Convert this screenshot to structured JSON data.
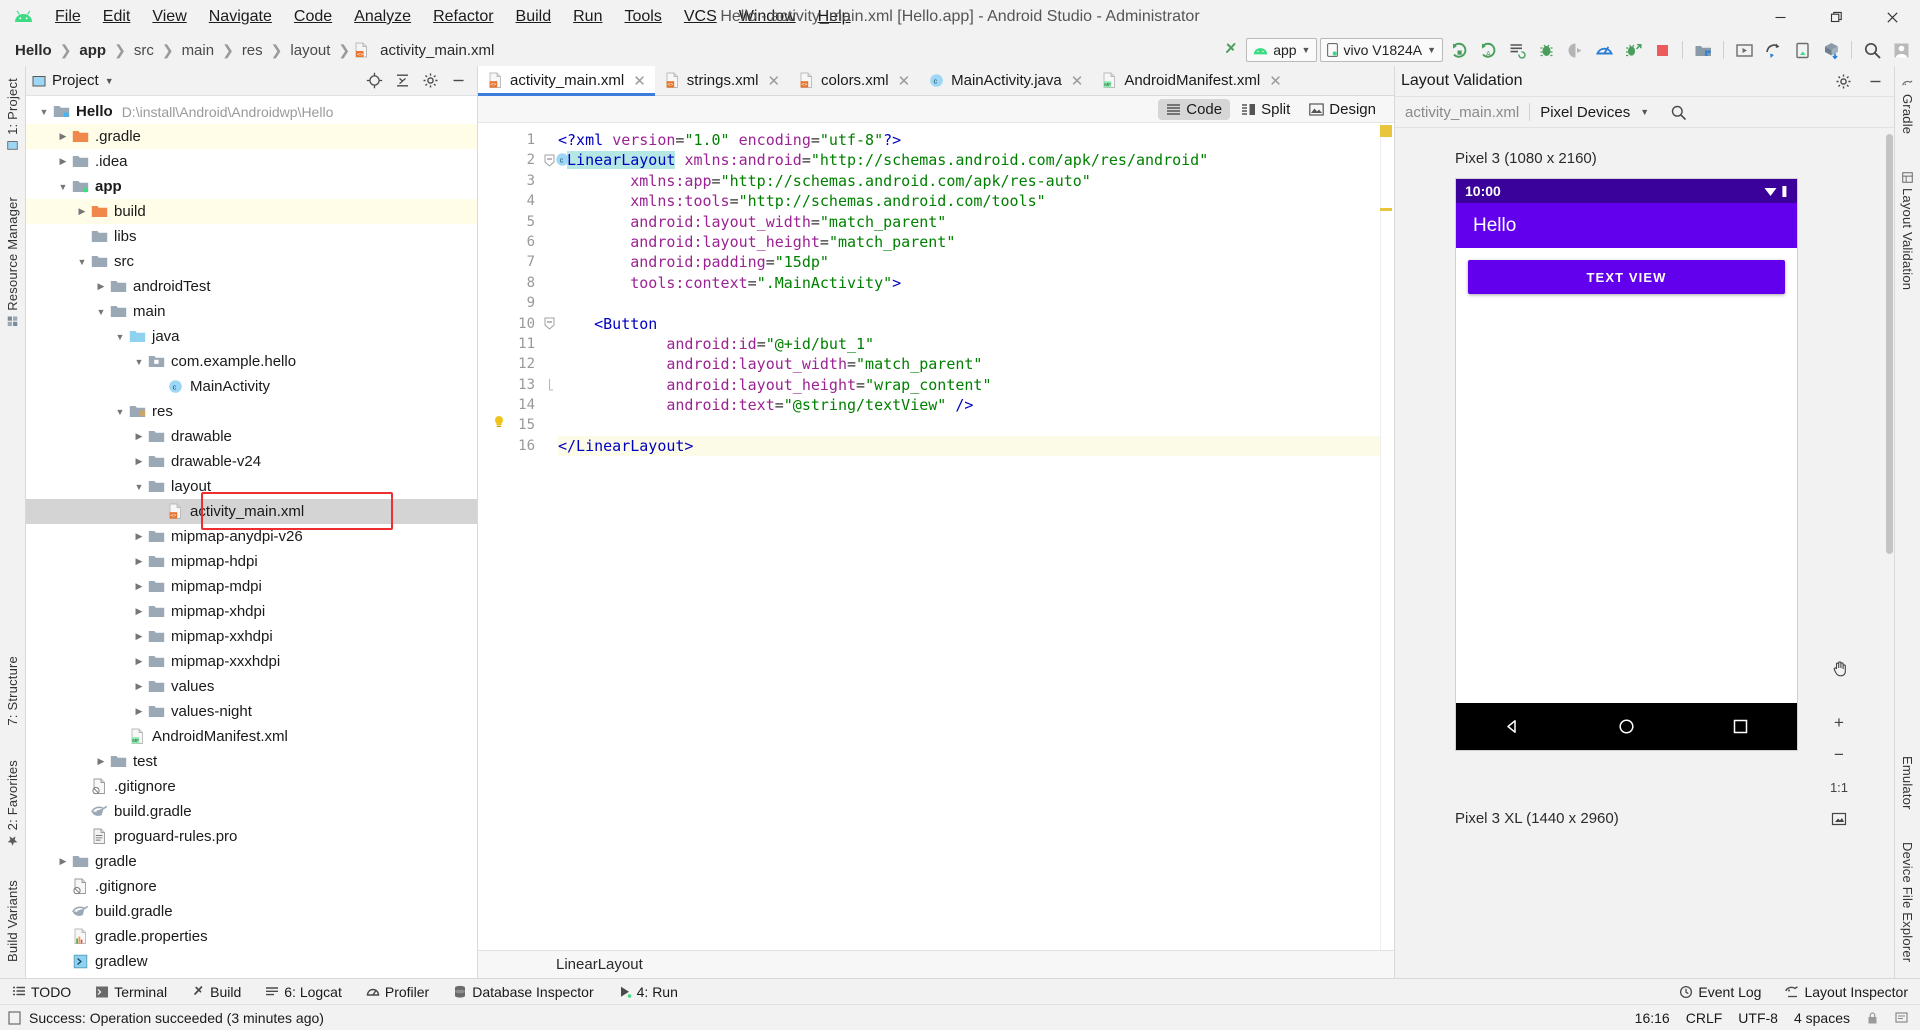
{
  "window": {
    "title": "Hello - activity_main.xml [Hello.app] - Android Studio - Administrator",
    "minimize": "—",
    "maximize": "❐",
    "close": "✕"
  },
  "menu": [
    {
      "label": "File"
    },
    {
      "label": "Edit"
    },
    {
      "label": "View"
    },
    {
      "label": "Navigate"
    },
    {
      "label": "Code"
    },
    {
      "label": "Analyze"
    },
    {
      "label": "Refactor"
    },
    {
      "label": "Build"
    },
    {
      "label": "Run"
    },
    {
      "label": "Tools"
    },
    {
      "label": "VCS"
    },
    {
      "label": "Window"
    },
    {
      "label": "Help"
    }
  ],
  "breadcrumbs": [
    {
      "label": "Hello",
      "style": "bold"
    },
    {
      "label": "app",
      "style": "bold"
    },
    {
      "label": "src",
      "style": "dim"
    },
    {
      "label": "main",
      "style": "dim"
    },
    {
      "label": "res",
      "style": "dim"
    },
    {
      "label": "layout",
      "style": "dim"
    },
    {
      "label": "activity_main.xml",
      "style": "file"
    }
  ],
  "toolbar": {
    "run_config": "app",
    "device": "vivo V1824A",
    "icons": [
      "run-icon",
      "debug-run-icon",
      "apply-changes-icon",
      "debug-icon",
      "attach-debugger-icon",
      "profiler-icon",
      "run-with-coverage-icon",
      "stop-icon",
      "sdk-manager-icon",
      "avd-manager-icon",
      "sync-project-icon",
      "device-manager-icon",
      "gradle-sync-icon",
      "search-icon",
      "user-icon"
    ]
  },
  "left_strips": [
    {
      "label": "1: Project",
      "name": "project"
    },
    {
      "label": "Resource Manager",
      "name": "resource-manager"
    },
    {
      "label": "7: Structure",
      "name": "structure"
    },
    {
      "label": "2: Favorites",
      "name": "favorites"
    },
    {
      "label": "Build Variants",
      "name": "build-variants"
    }
  ],
  "right_strips": [
    {
      "label": "Gradle",
      "name": "gradle"
    },
    {
      "label": "Layout Validation",
      "name": "layout-validation"
    },
    {
      "label": "Emulator",
      "name": "emulator"
    },
    {
      "label": "Device File Explorer",
      "name": "device-file-explorer"
    }
  ],
  "project_panel": {
    "title": "Project",
    "tree": [
      {
        "depth": 0,
        "arrow": "down",
        "icon": "module-root",
        "label": "Hello",
        "bold": true,
        "path": "D:\\install\\Android\\Androidwp\\Hello"
      },
      {
        "depth": 1,
        "arrow": "right",
        "icon": "folder-orange",
        "label": ".gradle",
        "highlight": "yellow"
      },
      {
        "depth": 1,
        "arrow": "right",
        "icon": "folder-gray",
        "label": ".idea"
      },
      {
        "depth": 1,
        "arrow": "down",
        "icon": "module",
        "label": "app",
        "bold": true
      },
      {
        "depth": 2,
        "arrow": "right",
        "icon": "folder-orange",
        "label": "build",
        "highlight": "yellow"
      },
      {
        "depth": 2,
        "arrow": "none",
        "icon": "folder-gray",
        "label": "libs"
      },
      {
        "depth": 2,
        "arrow": "down",
        "icon": "folder-gray",
        "label": "src"
      },
      {
        "depth": 3,
        "arrow": "right",
        "icon": "folder-gray",
        "label": "androidTest"
      },
      {
        "depth": 3,
        "arrow": "down",
        "icon": "folder-gray",
        "label": "main"
      },
      {
        "depth": 4,
        "arrow": "down",
        "icon": "folder-blue",
        "label": "java"
      },
      {
        "depth": 5,
        "arrow": "down",
        "icon": "package",
        "label": "com.example.hello"
      },
      {
        "depth": 6,
        "arrow": "none",
        "icon": "class",
        "label": "MainActivity"
      },
      {
        "depth": 4,
        "arrow": "down",
        "icon": "res-folder",
        "label": "res"
      },
      {
        "depth": 5,
        "arrow": "right",
        "icon": "folder-gray",
        "label": "drawable"
      },
      {
        "depth": 5,
        "arrow": "right",
        "icon": "folder-gray",
        "label": "drawable-v24"
      },
      {
        "depth": 5,
        "arrow": "down",
        "icon": "folder-gray",
        "label": "layout"
      },
      {
        "depth": 6,
        "arrow": "none",
        "icon": "xml-file",
        "label": "activity_main.xml",
        "selected": true,
        "boxed": true
      },
      {
        "depth": 5,
        "arrow": "right",
        "icon": "folder-gray",
        "label": "mipmap-anydpi-v26"
      },
      {
        "depth": 5,
        "arrow": "right",
        "icon": "folder-gray",
        "label": "mipmap-hdpi"
      },
      {
        "depth": 5,
        "arrow": "right",
        "icon": "folder-gray",
        "label": "mipmap-mdpi"
      },
      {
        "depth": 5,
        "arrow": "right",
        "icon": "folder-gray",
        "label": "mipmap-xhdpi"
      },
      {
        "depth": 5,
        "arrow": "right",
        "icon": "folder-gray",
        "label": "mipmap-xxhdpi"
      },
      {
        "depth": 5,
        "arrow": "right",
        "icon": "folder-gray",
        "label": "mipmap-xxxhdpi"
      },
      {
        "depth": 5,
        "arrow": "right",
        "icon": "folder-gray",
        "label": "values"
      },
      {
        "depth": 5,
        "arrow": "right",
        "icon": "folder-gray",
        "label": "values-night"
      },
      {
        "depth": 4,
        "arrow": "none",
        "icon": "manifest-file",
        "label": "AndroidManifest.xml"
      },
      {
        "depth": 3,
        "arrow": "right",
        "icon": "folder-gray",
        "label": "test"
      },
      {
        "depth": 2,
        "arrow": "none",
        "icon": "gitignore-file",
        "label": ".gitignore"
      },
      {
        "depth": 2,
        "arrow": "none",
        "icon": "gradle-file",
        "label": "build.gradle"
      },
      {
        "depth": 2,
        "arrow": "none",
        "icon": "text-file",
        "label": "proguard-rules.pro"
      },
      {
        "depth": 1,
        "arrow": "right",
        "icon": "folder-gray",
        "label": "gradle"
      },
      {
        "depth": 1,
        "arrow": "none",
        "icon": "gitignore-file",
        "label": ".gitignore"
      },
      {
        "depth": 1,
        "arrow": "none",
        "icon": "gradle-file",
        "label": "build.gradle"
      },
      {
        "depth": 1,
        "arrow": "none",
        "icon": "properties-file",
        "label": "gradle.properties"
      },
      {
        "depth": 1,
        "arrow": "none",
        "icon": "script-file",
        "label": "gradlew"
      }
    ]
  },
  "editor": {
    "tabs": [
      {
        "label": "activity_main.xml",
        "icon": "xml-file",
        "active": true
      },
      {
        "label": "strings.xml",
        "icon": "xml-file",
        "active": false
      },
      {
        "label": "colors.xml",
        "icon": "xml-file",
        "active": false
      },
      {
        "label": "MainActivity.java",
        "icon": "class",
        "active": false
      },
      {
        "label": "AndroidManifest.xml",
        "icon": "manifest-file",
        "active": false
      }
    ],
    "modes": [
      {
        "label": "Code",
        "selected": true,
        "icon": "code-view-icon"
      },
      {
        "label": "Split",
        "selected": false,
        "icon": "split-view-icon"
      },
      {
        "label": "Design",
        "selected": false,
        "icon": "design-view-icon"
      }
    ],
    "breadcrumb": "LinearLayout",
    "lines": [
      {
        "n": 1,
        "indent": 0,
        "tokens": [
          {
            "t": "decl",
            "v": "<?xml "
          },
          {
            "t": "attr",
            "v": "version"
          },
          {
            "t": "punc",
            "v": "="
          },
          {
            "t": "val",
            "v": "\"1.0\""
          },
          {
            "t": "punc",
            "v": " "
          },
          {
            "t": "attr",
            "v": "encoding"
          },
          {
            "t": "punc",
            "v": "="
          },
          {
            "t": "val",
            "v": "\"utf-8\""
          },
          {
            "t": "decl",
            "v": "?>"
          }
        ]
      },
      {
        "n": 2,
        "indent": 0,
        "gmark": "class-marker",
        "fold": "open",
        "tokens": [
          {
            "t": "tag",
            "v": "<"
          },
          {
            "t": "tagsel",
            "v": "LinearLayout"
          },
          {
            "t": "punc",
            "v": " "
          },
          {
            "t": "attr",
            "v": "xmlns:android"
          },
          {
            "t": "punc",
            "v": "="
          },
          {
            "t": "val",
            "v": "\"http://schemas.android.com/apk/res/android\""
          }
        ]
      },
      {
        "n": 3,
        "indent": 4,
        "tokens": [
          {
            "t": "attr",
            "v": "xmlns:app"
          },
          {
            "t": "punc",
            "v": "="
          },
          {
            "t": "val",
            "v": "\"http://schemas.android.com/apk/res-auto\""
          }
        ]
      },
      {
        "n": 4,
        "indent": 4,
        "tokens": [
          {
            "t": "attr",
            "v": "xmlns:tools"
          },
          {
            "t": "punc",
            "v": "="
          },
          {
            "t": "val",
            "v": "\"http://schemas.android.com/tools\""
          }
        ]
      },
      {
        "n": 5,
        "indent": 4,
        "tokens": [
          {
            "t": "attr",
            "v": "android:layout_width"
          },
          {
            "t": "punc",
            "v": "="
          },
          {
            "t": "val",
            "v": "\"match_parent\""
          }
        ]
      },
      {
        "n": 6,
        "indent": 4,
        "tokens": [
          {
            "t": "attr",
            "v": "android:layout_height"
          },
          {
            "t": "punc",
            "v": "="
          },
          {
            "t": "val",
            "v": "\"match_parent\""
          }
        ]
      },
      {
        "n": 7,
        "indent": 4,
        "tokens": [
          {
            "t": "attr",
            "v": "android:padding"
          },
          {
            "t": "punc",
            "v": "="
          },
          {
            "t": "val",
            "v": "\"15dp\""
          }
        ]
      },
      {
        "n": 8,
        "indent": 4,
        "tokens": [
          {
            "t": "attr",
            "v": "tools:context"
          },
          {
            "t": "punc",
            "v": "="
          },
          {
            "t": "val",
            "v": "\".MainActivity\""
          },
          {
            "t": "tag",
            "v": ">"
          }
        ]
      },
      {
        "n": 9,
        "indent": 0,
        "tokens": []
      },
      {
        "n": 10,
        "indent": 2,
        "fold": "open",
        "tokens": [
          {
            "t": "tag",
            "v": "<Button"
          }
        ]
      },
      {
        "n": 11,
        "indent": 6,
        "tokens": [
          {
            "t": "attr",
            "v": "android:id"
          },
          {
            "t": "punc",
            "v": "="
          },
          {
            "t": "val",
            "v": "\"@+id/but_1\""
          }
        ]
      },
      {
        "n": 12,
        "indent": 6,
        "tokens": [
          {
            "t": "attr",
            "v": "android:layout_width"
          },
          {
            "t": "punc",
            "v": "="
          },
          {
            "t": "val",
            "v": "\"match_parent\""
          }
        ]
      },
      {
        "n": 13,
        "indent": 6,
        "fold": "end",
        "tokens": [
          {
            "t": "attr",
            "v": "android:layout_height"
          },
          {
            "t": "punc",
            "v": "="
          },
          {
            "t": "val",
            "v": "\"wrap_content\""
          }
        ]
      },
      {
        "n": 14,
        "indent": 6,
        "tokens": [
          {
            "t": "attr",
            "v": "android:text"
          },
          {
            "t": "punc",
            "v": "="
          },
          {
            "t": "val",
            "v": "\"@string/textView\""
          },
          {
            "t": "tag",
            "v": " />"
          }
        ]
      },
      {
        "n": 15,
        "indent": 0,
        "bulb": true,
        "tokens": []
      },
      {
        "n": 16,
        "indent": 0,
        "hl": true,
        "tokens": [
          {
            "t": "tag",
            "v": "</LinearLayout>"
          }
        ]
      }
    ]
  },
  "layout_validation": {
    "title": "Layout Validation",
    "file_name": "activity_main.xml",
    "device_set": "Pixel Devices",
    "devices": [
      {
        "label": "Pixel 3 (1080 x 2160)",
        "status_time": "10:00",
        "app_title": "Hello",
        "button_text": "TEXT VIEW"
      },
      {
        "label": "Pixel 3 XL (1440 x 2960)"
      }
    ],
    "tools": [
      "pan-icon",
      "zoom-in-icon",
      "zoom-out-icon",
      "zoom-actual-icon",
      "zoom-fit-icon"
    ],
    "zoom_actual_label": "1:1"
  },
  "bottom_toolbar": [
    {
      "label": "TODO",
      "icon": "todo-icon",
      "mnemonic": ""
    },
    {
      "label": "Terminal",
      "icon": "terminal-icon",
      "mnemonic": ""
    },
    {
      "label": "Build",
      "icon": "build-icon",
      "mnemonic": ""
    },
    {
      "label": "6: Logcat",
      "icon": "logcat-icon",
      "mnemonic": "6"
    },
    {
      "label": "Profiler",
      "icon": "profiler-icon",
      "mnemonic": ""
    },
    {
      "label": "Database Inspector",
      "icon": "database-icon",
      "mnemonic": ""
    },
    {
      "label": "4: Run",
      "icon": "run-small-icon",
      "mnemonic": "4"
    }
  ],
  "bottom_right_toolbar": [
    {
      "label": "Event Log",
      "icon": "event-log-icon"
    },
    {
      "label": "Layout Inspector",
      "icon": "layout-inspector-icon"
    }
  ],
  "status_bar": {
    "message": "Success: Operation succeeded (3 minutes ago)",
    "time": "16:16",
    "line_sep": "CRLF",
    "encoding": "UTF-8",
    "indent": "4 spaces"
  },
  "colors": {
    "accent_blue": "#3b7ddd",
    "android_green": "#3ddc84",
    "selection_gray": "#d4d4d4",
    "highlight_yellow": "#fffce8",
    "red_box": "#ef2f2f",
    "purple_primary": "#6200ee",
    "purple_dark": "#3b029b",
    "tag_blue": "#0000c0",
    "attr_purple": "#9b2393",
    "value_green": "#008000"
  }
}
